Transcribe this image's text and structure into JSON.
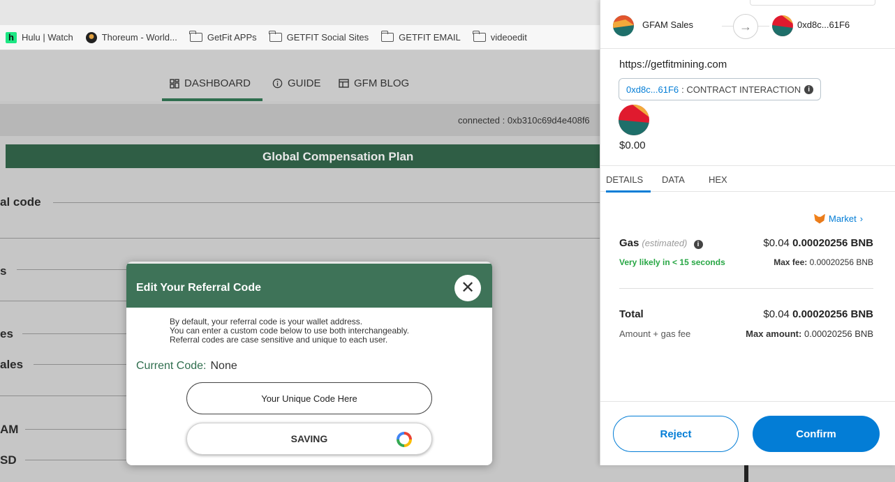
{
  "bookmarks": [
    {
      "label": "Hulu | Watch",
      "icon": "hulu-icon"
    },
    {
      "label": "Thoreum - World...",
      "icon": "thoreum-icon"
    },
    {
      "label": "GetFit APPs",
      "icon": "folder-icon"
    },
    {
      "label": "GETFIT Social Sites",
      "icon": "folder-icon"
    },
    {
      "label": "GETFIT EMAIL",
      "icon": "folder-icon"
    },
    {
      "label": "videoedit",
      "icon": "folder-icon"
    }
  ],
  "nav": {
    "dashboard": "DASHBOARD",
    "guide": "GUIDE",
    "blog": "GFM BLOG"
  },
  "connected_text": "connected : 0xb310c69d4e408f6",
  "plan_title": "Global Compensation Plan",
  "row_labels": [
    "al code",
    "s",
    "es",
    "ales",
    "AM",
    "SD"
  ],
  "modal": {
    "title": "Edit Your Referral Code",
    "close_symbol": "✕",
    "desc_line1": "By default, your referral code is your wallet address.",
    "desc_line2": "You can enter a custom code below to use both interchangeably.",
    "desc_line3": "Referral codes are case sensitive and unique to each user.",
    "current_code_label": "Current Code:",
    "current_code_value": "None",
    "input_placeholder": "Your Unique Code Here",
    "saving_label": "SAVING"
  },
  "wallet": {
    "from_account": "GFAM Sales",
    "to_address": "0xd8c...61F6",
    "origin": "https://getfitmining.com",
    "contract_addr": "0xd8c...61F6",
    "contract_label": ": CONTRACT INTERACTION",
    "amount": "$0.00",
    "tabs": [
      "DETAILS",
      "DATA",
      "HEX"
    ],
    "market": "Market",
    "gas_label": "Gas",
    "gas_estimated": "(estimated)",
    "gas_fiat": "$0.04",
    "gas_bnb": "0.00020256 BNB",
    "likely": "Very likely in < 15 seconds",
    "maxfee_label": "Max fee:",
    "maxfee_value": "0.00020256 BNB",
    "total_label": "Total",
    "total_fiat": "$0.04",
    "total_bnb": "0.00020256 BNB",
    "amount_gas_label": "Amount + gas fee",
    "maxamount_label": "Max amount:",
    "maxamount_value": "0.00020256 BNB",
    "reject": "Reject",
    "confirm": "Confirm"
  },
  "colors": {
    "brand_green": "#2f5e45",
    "modal_header": "#3e7358",
    "wallet_blue": "#037dd6",
    "success_green": "#28a745"
  }
}
